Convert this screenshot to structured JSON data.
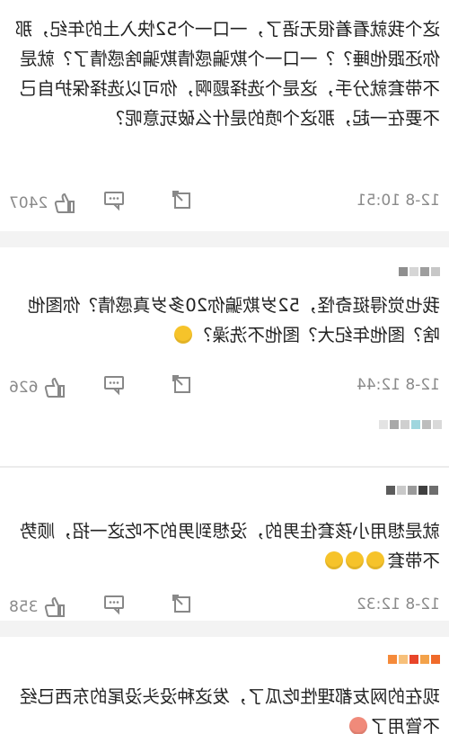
{
  "comments": [
    {
      "text": "这个我就看着很无语了，一口一个52快入土的年纪，那你还跟他睡？？一口一个欺骗感情欺骗啥感情了？就是不带套就分手，这是个选择题啊，你可以选择保护自己不要在一起，那这个喷的是什么破玩意呢？",
      "time": "12-8 10:51",
      "likes": "2407"
    },
    {
      "text": "我也觉得挺奇怪，52岁欺骗你20多岁真感情？你图他啥？图他年纪大？图他不洗澡？",
      "time": "12-8 12:44",
      "likes": "626"
    },
    {
      "text": "就是想用小孩套住男的，没想到男的不吃这一招，顺势不带套",
      "time": "12-8 12:32",
      "likes": "358"
    },
    {
      "text": "现在的网友都理性吃瓜了，发这种没头没尾的东西已经不管用了",
      "time": "",
      "likes": ""
    }
  ],
  "icons": [
    "like-icon",
    "comment-icon",
    "share-icon"
  ],
  "colors": {
    "bg": "#ffffff",
    "divider": "#f3f3f3",
    "meta": "#8a8a8a",
    "emoji": "#f6c32a"
  }
}
